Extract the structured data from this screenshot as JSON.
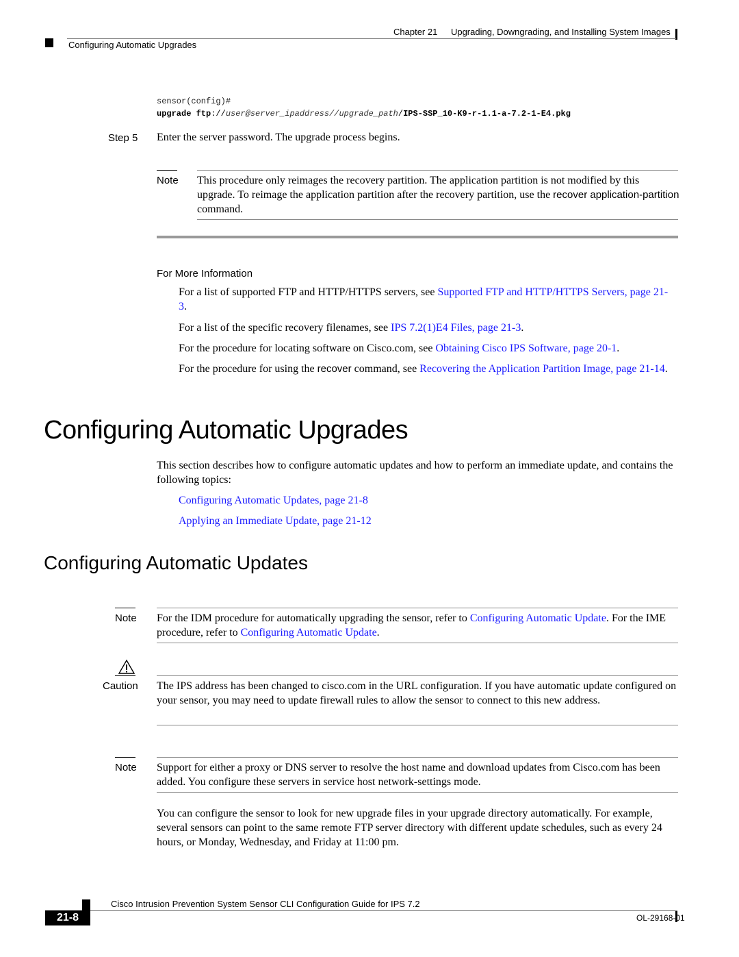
{
  "header": {
    "chapter": "Chapter 21",
    "chapter_title": "Upgrading, Downgrading, and Installing System Images",
    "section": "Configuring Automatic Upgrades"
  },
  "code": {
    "prompt": "sensor(config)#",
    "cmd_bold": "upgrade ftp",
    "cmd_sep1": "://",
    "cmd_user": "user",
    "cmd_at": "@",
    "cmd_server": "server_ipaddress",
    "cmd_sep2": "//",
    "cmd_path": "upgrade_path",
    "cmd_sep3": "/",
    "cmd_file": "IPS-SSP_10-K9-r-1.1-a-7.2-1-E4.pkg"
  },
  "step5": {
    "label": "Step 5",
    "text": "Enter the server password. The upgrade process begins."
  },
  "note1": {
    "label": "Note",
    "text_before": "This procedure only reimages the recovery partition. The application partition is not modified by this upgrade. To reimage the application partition after the recovery partition, use the ",
    "command": "recover application-partition",
    "text_after": " command."
  },
  "more_info": {
    "heading": "For More Information",
    "items": [
      {
        "text": "For a list of supported FTP and HTTP/HTTPS servers, see ",
        "link": "Supported FTP and HTTP/HTTPS Servers, page 21-3",
        "after": "."
      },
      {
        "text": "For a list of the specific recovery filenames, see ",
        "link": "IPS 7.2(1)E4 Files, page 21-3",
        "after": "."
      },
      {
        "text": "For the procedure for locating software on Cisco.com, see ",
        "link": "Obtaining Cisco IPS Software, page 20-1",
        "after": "."
      },
      {
        "text_before_cmd": "For the procedure for using the ",
        "command": "recover",
        "text": " command, see ",
        "link": "Recovering the Application Partition Image, page 21-14",
        "after": "."
      }
    ]
  },
  "section_upgrades": {
    "title": "Configuring Automatic Upgrades",
    "intro": "This section describes how to configure automatic updates and how to perform an immediate update, and contains the following topics:",
    "topics": [
      "Configuring Automatic Updates, page 21-8",
      "Applying an Immediate Update, page 21-12"
    ]
  },
  "section_updates": {
    "title": "Configuring Automatic Updates",
    "note2": {
      "label": "Note",
      "t1": "For the IDM procedure for automatically upgrading the sensor, refer to ",
      "l1": "Configuring Automatic Update",
      "t2": ". For the IME procedure, refer to ",
      "l2": "Configuring Automatic Update",
      "t3": "."
    },
    "caution": {
      "label": "Caution",
      "icon": "warning-triangle-icon",
      "text": "The IPS address has been changed to cisco.com in the URL configuration. If you have automatic update configured on your sensor, you may need to update firewall rules to allow the sensor to connect to this new address."
    },
    "note3": {
      "label": "Note",
      "text": "Support for either a proxy or DNS server to resolve the host name and download updates from Cisco.com has been added. You configure these servers in service host network-settings mode."
    },
    "body": "You can configure the sensor to look for new upgrade files in your upgrade directory automatically. For example, several sensors can point to the same remote FTP server directory with different update schedules, such as every 24 hours, or Monday, Wednesday, and Friday at 11:00 pm."
  },
  "footer": {
    "title": "Cisco Intrusion Prevention System Sensor CLI Configuration Guide for IPS 7.2",
    "page": "21-8",
    "doc_id": "OL-29168-01"
  },
  "colors": {
    "link": "#1a1aff",
    "text": "#000000",
    "rule": "#888888"
  }
}
